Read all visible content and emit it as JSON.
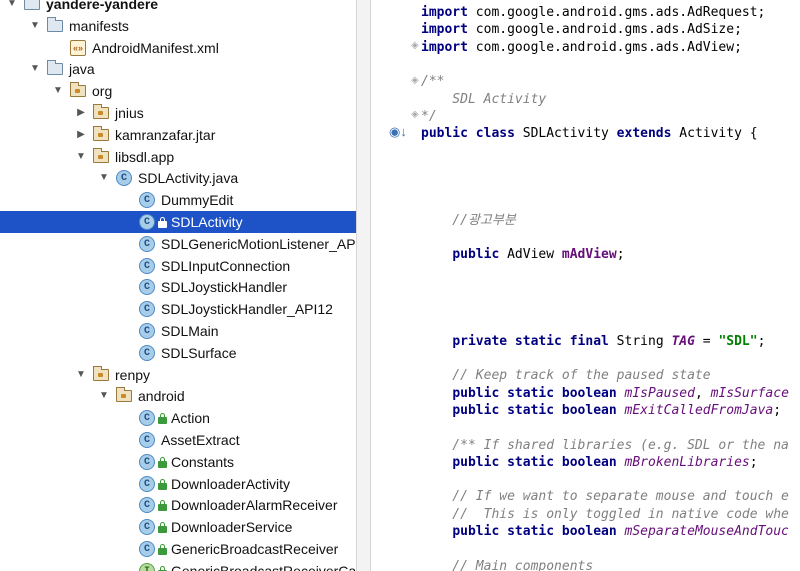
{
  "project_tree": {
    "items": [
      {
        "label": "yandere-yandere",
        "icon": "module-icon",
        "expanded": true,
        "bold": true
      },
      {
        "label": "manifests",
        "icon": "folder-icon",
        "expanded": true
      },
      {
        "label": "AndroidManifest.xml",
        "icon": "xml-file-icon"
      },
      {
        "label": "java",
        "icon": "folder-icon",
        "expanded": true
      },
      {
        "label": "org",
        "icon": "package-icon",
        "expanded": true
      },
      {
        "label": "jnius",
        "icon": "package-icon",
        "expanded": false
      },
      {
        "label": "kamranzafar.jtar",
        "icon": "package-icon",
        "expanded": false
      },
      {
        "label": "libsdl.app",
        "icon": "package-icon",
        "expanded": true
      },
      {
        "label": "SDLActivity.java",
        "icon": "class-icon",
        "glyph": "C",
        "expanded": true
      },
      {
        "label": "DummyEdit",
        "icon": "class-icon",
        "glyph": "C"
      },
      {
        "label": "SDLActivity",
        "icon": "class-icon",
        "glyph": "C",
        "locked": true,
        "selected": true
      },
      {
        "label": "SDLGenericMotionListener_API",
        "icon": "class-icon",
        "glyph": "C"
      },
      {
        "label": "SDLInputConnection",
        "icon": "class-icon",
        "glyph": "C"
      },
      {
        "label": "SDLJoystickHandler",
        "icon": "class-icon",
        "glyph": "C"
      },
      {
        "label": "SDLJoystickHandler_API12",
        "icon": "class-icon",
        "glyph": "C"
      },
      {
        "label": "SDLMain",
        "icon": "class-icon",
        "glyph": "C"
      },
      {
        "label": "SDLSurface",
        "icon": "class-icon",
        "glyph": "C"
      },
      {
        "label": "renpy",
        "icon": "package-icon",
        "expanded": true
      },
      {
        "label": "android",
        "icon": "package-icon",
        "expanded": true
      },
      {
        "label": "Action",
        "icon": "class-icon",
        "glyph": "C",
        "locked": true
      },
      {
        "label": "AssetExtract",
        "icon": "class-icon",
        "glyph": "C"
      },
      {
        "label": "Constants",
        "icon": "class-icon",
        "glyph": "C",
        "locked": true
      },
      {
        "label": "DownloaderActivity",
        "icon": "class-icon",
        "glyph": "C",
        "locked": true
      },
      {
        "label": "DownloaderAlarmReceiver",
        "icon": "class-icon",
        "glyph": "C",
        "locked": true
      },
      {
        "label": "DownloaderService",
        "icon": "class-icon",
        "glyph": "C",
        "locked": true
      },
      {
        "label": "GenericBroadcastReceiver",
        "icon": "class-icon",
        "glyph": "C",
        "locked": true
      },
      {
        "label": "GenericBroadcastReceiverCal",
        "icon": "interface-icon",
        "glyph": "I",
        "locked": true
      }
    ]
  },
  "editor": {
    "lines": [
      [
        [
          "kw",
          "import"
        ],
        [
          "p",
          " com.google.android.gms.ads.AdRequest;"
        ]
      ],
      [
        [
          "kw",
          "import"
        ],
        [
          "p",
          " com.google.android.gms.ads.AdSize;"
        ]
      ],
      [
        [
          "kw",
          "import"
        ],
        [
          "p",
          " com.google.android.gms.ads.AdView;"
        ]
      ],
      [],
      [
        [
          "cm",
          "/**"
        ]
      ],
      [
        [
          "cm",
          "    SDL Activity"
        ]
      ],
      [
        [
          "cm",
          "*/"
        ]
      ],
      [
        [
          "kw",
          "public class"
        ],
        [
          "p",
          " SDLActivity "
        ],
        [
          "kw",
          "extends"
        ],
        [
          "p",
          " Activity {"
        ]
      ],
      [],
      [],
      [],
      [],
      [
        [
          "cm",
          "    //광고부분"
        ]
      ],
      [],
      [
        [
          "p",
          "    "
        ],
        [
          "kw",
          "public"
        ],
        [
          "p",
          " AdView "
        ],
        [
          "fld",
          "mAdView"
        ],
        [
          "p",
          ";"
        ]
      ],
      [],
      [],
      [],
      [],
      [
        [
          "p",
          "    "
        ],
        [
          "kw",
          "private static final"
        ],
        [
          "p",
          " String "
        ],
        [
          "fldi",
          "TAG"
        ],
        [
          "p",
          " = "
        ],
        [
          "str",
          "\"SDL\""
        ],
        [
          "p",
          ";"
        ]
      ],
      [],
      [
        [
          "cm",
          "    // Keep track of the paused state"
        ]
      ],
      [
        [
          "p",
          "    "
        ],
        [
          "kw",
          "public static boolean"
        ],
        [
          "p",
          " "
        ],
        [
          "fldn",
          "mIsPaused"
        ],
        [
          "p",
          ", "
        ],
        [
          "fldn",
          "mIsSurface"
        ]
      ],
      [
        [
          "p",
          "    "
        ],
        [
          "kw",
          "public static boolean"
        ],
        [
          "p",
          " "
        ],
        [
          "fldn",
          "mExitCalledFromJava"
        ],
        [
          "p",
          ";"
        ]
      ],
      [],
      [
        [
          "cm",
          "    /** If shared libraries (e.g. SDL or the na"
        ]
      ],
      [
        [
          "p",
          "    "
        ],
        [
          "kw",
          "public static boolean"
        ],
        [
          "p",
          " "
        ],
        [
          "fldn",
          "mBrokenLibraries"
        ],
        [
          "p",
          ";"
        ]
      ],
      [],
      [
        [
          "cm",
          "    // If we want to separate mouse and touch e"
        ]
      ],
      [
        [
          "cm",
          "    //  This is only toggled in native code whe"
        ]
      ],
      [
        [
          "p",
          "    "
        ],
        [
          "kw",
          "public static boolean"
        ],
        [
          "p",
          " "
        ],
        [
          "fldn",
          "mSeparateMouseAndTouc"
        ]
      ],
      [],
      [
        [
          "cm",
          "    // Main components"
        ]
      ]
    ]
  }
}
